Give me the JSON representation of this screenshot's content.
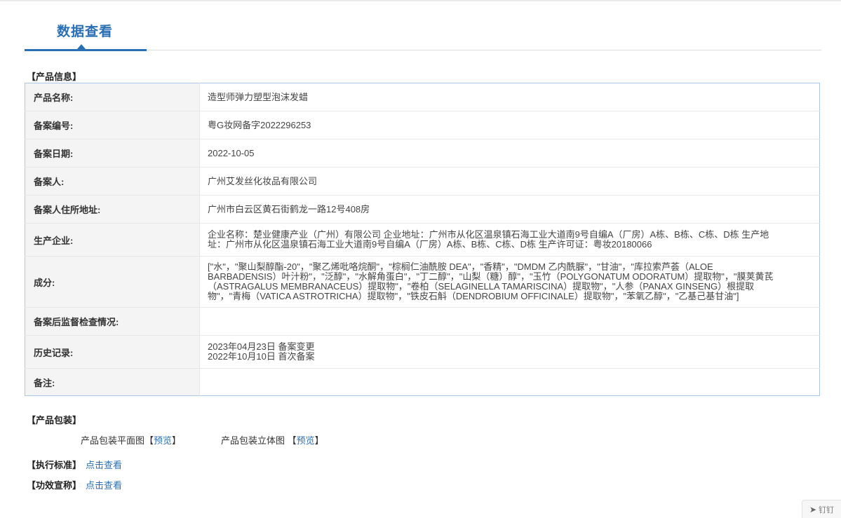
{
  "header": {
    "title": "数据查看"
  },
  "sections": {
    "product_info": "【产品信息】",
    "packaging": "【产品包装】",
    "standard": "【执行标准】",
    "efficacy": "【功效宣称】"
  },
  "product": {
    "name_label": "产品名称:",
    "name": "造型师弹力塑型泡沫发蜡",
    "record_no_label": "备案编号:",
    "record_no": "粤G妆网备字2022296253",
    "record_date_label": "备案日期:",
    "record_date": "2022-10-05",
    "filer_label": "备案人:",
    "filer": "广州艾发丝化妆品有限公司",
    "filer_address_label": "备案人住所地址:",
    "filer_address": "广州市白云区黄石街鹤龙一路12号408房",
    "manufacturer_label": "生产企业:",
    "manufacturer": "企业名称：楚业健康产业（广州）有限公司 企业地址：广州市从化区温泉镇石海工业大道南9号自编A（厂房）A栋、B栋、C栋、D栋 生产地址：广州市从化区温泉镇石海工业大道南9号自编A（厂房）A栋、B栋、C栋、D栋 生产许可证：粤妆20180066",
    "ingredients_label": "成分:",
    "ingredients": "[\"水\"，\"聚山梨醇酯-20\"，\"聚乙烯吡咯烷酮\"，\"棕榈仁油酰胺 DEA\"，\"香精\"，\"DMDM 乙内酰脲\"，\"甘油\"，\"库拉索芦荟（ALOE BARBADENSIS）叶汁粉\"，\"泛醇\"，\"水解角蛋白\"，\"丁二醇\"，\"山梨（糖）醇\"，\"玉竹（POLYGONATUM ODORATUM）提取物\"，\"膜荚黄芪（ASTRAGALUS MEMBRANACEUS）提取物\"，\"卷柏（SELAGINELLA TAMARISCINA）提取物\"，\"人参（PANAX GINSENG）根提取物\"，\"青梅（VATICA ASTROTRICHA）提取物\"，\"铁皮石斛（DENDROBIUM OFFICINALE）提取物\"，\"苯氧乙醇\"，\"乙基己基甘油\"]",
    "supervision_label": "备案后监督检查情况:",
    "supervision": "",
    "history_label": "历史记录:",
    "history": [
      "2023年04月23日 备案变更",
      "2022年10月10日 首次备案"
    ],
    "remarks_label": "备注:",
    "remarks": ""
  },
  "packaging": {
    "flat_label": "产品包装平面图",
    "solid_label": "产品包装立体图",
    "bracket_open": "【",
    "bracket_close": "】",
    "preview": "预览"
  },
  "links": {
    "view": "点击查看"
  },
  "widget": {
    "label": "钉钉"
  }
}
